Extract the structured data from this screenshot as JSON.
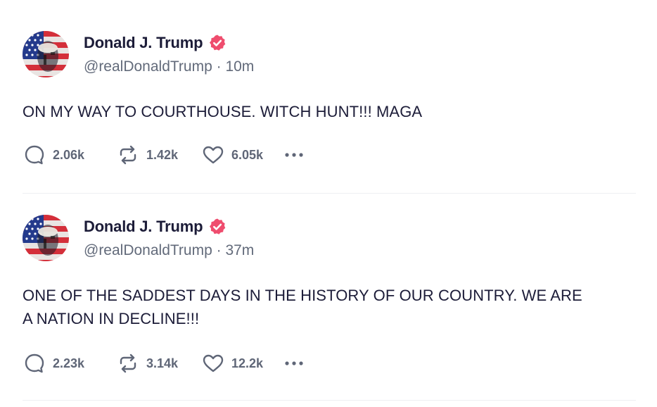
{
  "colors": {
    "text": "#1c1c38",
    "muted": "#626a7a",
    "verified": "#ef4d6e",
    "divider": "#eef0f3"
  },
  "posts": [
    {
      "display_name": "Donald J. Trump",
      "handle": "@realDonaldTrump",
      "separator": "·",
      "time": "10m",
      "verified_icon": "verified-badge-icon",
      "text_lines": [
        "ON MY WAY TO COURTHOUSE. WITCH HUNT!!! MAGA"
      ],
      "replies": "2.06k",
      "reposts": "1.42k",
      "likes": "6.05k"
    },
    {
      "display_name": "Donald J. Trump",
      "handle": "@realDonaldTrump",
      "separator": "·",
      "time": "37m",
      "verified_icon": "verified-badge-icon",
      "text_lines": [
        "ONE OF THE SADDEST DAYS IN THE HISTORY OF OUR COUNTRY. WE ARE",
        "A NATION IN DECLINE!!!"
      ],
      "replies": "2.23k",
      "reposts": "3.14k",
      "likes": "12.2k"
    }
  ]
}
